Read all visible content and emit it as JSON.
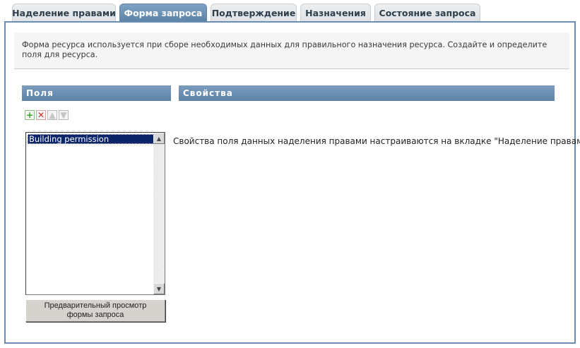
{
  "tabs": [
    {
      "label": "Наделение правами",
      "active": false
    },
    {
      "label": "Форма запроса",
      "active": true
    },
    {
      "label": "Подтверждение",
      "active": false
    },
    {
      "label": "Назначения",
      "active": false
    },
    {
      "label": "Состояние запроса",
      "active": false
    }
  ],
  "info_text": "Форма ресурса используется при сборе необходимых данных для правильного назначения ресурса. Создайте и определите поля для ресурса.",
  "fields": {
    "header": "Поля",
    "items": [
      "Building permission"
    ],
    "selected_index": 0,
    "toolbar_icons": [
      "add-icon",
      "delete-icon",
      "move-up-icon",
      "move-down-icon"
    ],
    "preview_button_line1": "Предварительный просмотр",
    "preview_button_line2": "формы запроса"
  },
  "properties": {
    "header": "Свойства",
    "text": "Свойства поля данных наделения правами настраиваются на вкладке \"Наделение правами\"."
  },
  "colors": {
    "accent": "#6a8db0",
    "active_tab": "#6b91b5",
    "selection": "#0a246a"
  }
}
